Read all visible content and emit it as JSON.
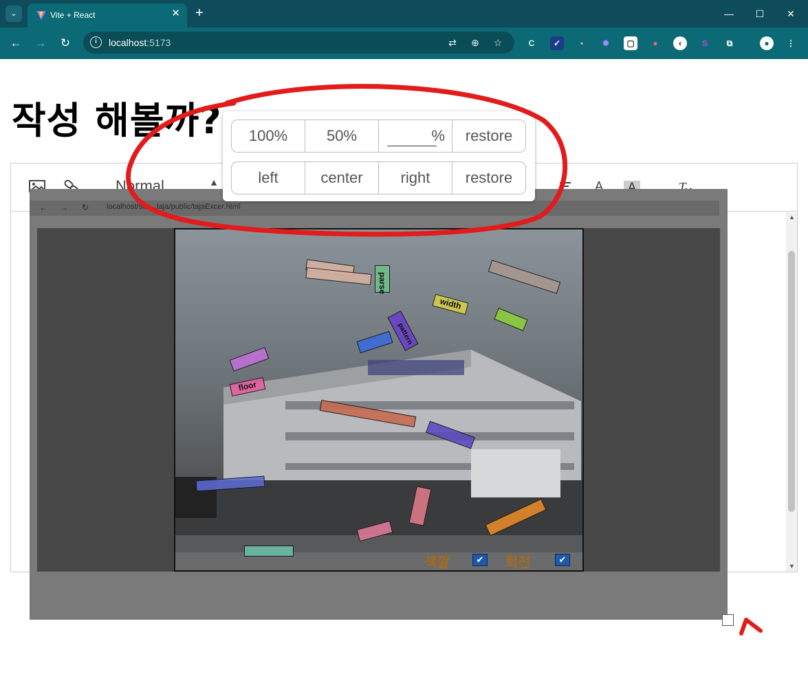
{
  "browser": {
    "tab_title": "Vite + React",
    "url_host": "localhost",
    "url_port": ":5173",
    "tab_close": "✕",
    "new_tab": "+",
    "window_minimize": "—",
    "window_maximize": "☐",
    "window_close": "✕"
  },
  "page": {
    "heading": "작성 해볼까?"
  },
  "editor_toolbar": {
    "header_select": "Normal",
    "icons": [
      "image-icon",
      "link-icon",
      "align-icon",
      "font-color-icon",
      "background-color-icon",
      "clear-format-icon"
    ]
  },
  "image_resize_popup": {
    "size_buttons": [
      {
        "label": "100%"
      },
      {
        "label": "50%"
      },
      {
        "label": "%"
      },
      {
        "label": "restore"
      }
    ],
    "custom_percent_value": "",
    "align_buttons": [
      {
        "label": "left"
      },
      {
        "label": "center"
      },
      {
        "label": "right"
      },
      {
        "label": "restore"
      }
    ]
  },
  "embedded_screenshot": {
    "url": "localhost/site...taja/public/tajaExcer.html",
    "words": [
      "parse",
      "width",
      "floor",
      "pattern"
    ],
    "checkbox_labels": [
      "색깔",
      "회전"
    ]
  },
  "annotation_colors": {
    "circle": "#e21b1b",
    "arrow": "#e21b1b"
  }
}
